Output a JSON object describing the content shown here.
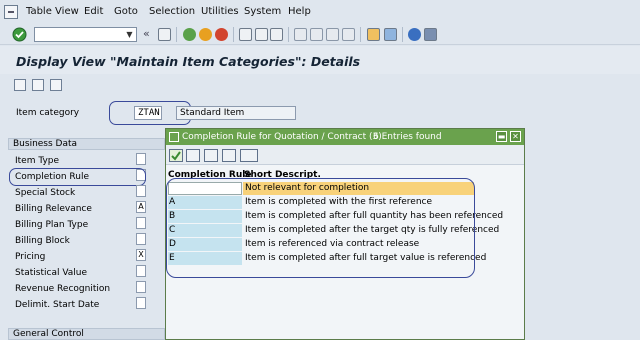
{
  "menu": {
    "items": [
      "Table View",
      "Edit",
      "Goto",
      "Selection",
      "Utilities",
      "System",
      "Help"
    ]
  },
  "toolbar": {
    "command_field_value": ""
  },
  "page": {
    "title": "Display View \"Maintain Item Categories\": Details"
  },
  "item_category": {
    "label": "Item category",
    "code": "ZTAN",
    "description": "Standard Item"
  },
  "business_data": {
    "header": "Business Data",
    "fields": [
      {
        "label": "Item Type",
        "value": ""
      },
      {
        "label": "Completion Rule",
        "value": ""
      },
      {
        "label": "Special Stock",
        "value": ""
      },
      {
        "label": "Billing Relevance",
        "value": "A"
      },
      {
        "label": "Billing Plan Type",
        "value": ""
      },
      {
        "label": "Billing Block",
        "value": ""
      },
      {
        "label": "Pricing",
        "value": "X"
      },
      {
        "label": "Statistical Value",
        "value": ""
      },
      {
        "label": "Revenue Recognition",
        "value": ""
      },
      {
        "label": "Delimit. Start Date",
        "value": ""
      }
    ]
  },
  "general_control": {
    "header": "General Control"
  },
  "popup": {
    "title": "Completion Rule for Quotation / Contract (3)",
    "entries_found": "6 Entries found",
    "columns": [
      "Completion Rule",
      "Short Descript."
    ],
    "rows": [
      {
        "rule": "",
        "description": "Not relevant for completion",
        "selected": true
      },
      {
        "rule": "A",
        "description": "Item is completed with the first reference"
      },
      {
        "rule": "B",
        "description": "Item is completed after full quantity has been referenced"
      },
      {
        "rule": "C",
        "description": "Item is completed after the target qty is fully referenced"
      },
      {
        "rule": "D",
        "description": "Item is referenced via contract release"
      },
      {
        "rule": "E",
        "description": "Item is completed after full target value is referenced"
      }
    ]
  },
  "colors": {
    "popup_title_bg": "#6aa24d",
    "rule_cell_bg": "#c5e3ef",
    "selected_row_bg": "#f8d27a",
    "highlight_oval": "#3a4a9a"
  }
}
